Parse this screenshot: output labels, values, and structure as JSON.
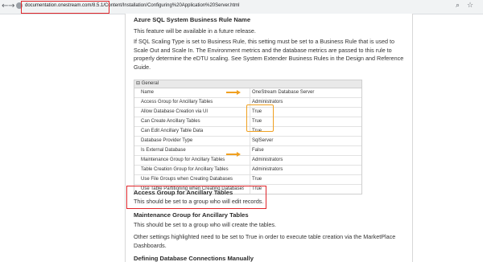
{
  "browser": {
    "back": "←",
    "forward": "→",
    "reload": "⟳",
    "url": "documentation.onestream.com/8.5.1/Content/Installation/Configuring%20Application%20Server.html"
  },
  "sections": {
    "azure_heading": "Azure SQL System Business Rule Name",
    "azure_p1": "This feature will be available in a future release.",
    "azure_p2": "If SQL Scaling Type is set to Business Rule, this setting must be set to a Business Rule that is used to Scale Out and Scale In.  The Environment metrics and the database metrics are passed to this rule to properly determine the eDTU scaling. See System Extender Business Rules in the Design and Reference Guide.",
    "table_group": "General",
    "table_toggle": "⊟",
    "rows": [
      {
        "name": "Name",
        "value": "OneStream Database Server"
      },
      {
        "name": "Access Group for Ancillary Tables",
        "value": "Administrators"
      },
      {
        "name": "Allow Database Creation via UI",
        "value": "True"
      },
      {
        "name": "Can Create Ancillary Tables",
        "value": "True"
      },
      {
        "name": "Can Edit Ancillary Table Data",
        "value": "True"
      },
      {
        "name": "Database Provider Type",
        "value": "SqlServer"
      },
      {
        "name": "Is External Database",
        "value": "False"
      },
      {
        "name": "Maintenance Group for Ancillary Tables",
        "value": "Administrators"
      },
      {
        "name": "Table Creation Group for Ancillary Tables",
        "value": "Administrators"
      },
      {
        "name": "Use File Groups when Creating Databases",
        "value": "True"
      },
      {
        "name": "Use Table Partitioning when Creating Databases",
        "value": "True"
      }
    ],
    "access_heading": "Access Group for Ancillary Tables",
    "access_p": "This should be set to a group who will edit records.",
    "maint_heading": "Maintenance Group for Ancillary Tables",
    "maint_p": "This should be set to a group who will create the tables.",
    "other_p": "Other settings highlighted need to be set to True in order to execute table creation via the MarketPlace Dashboards.",
    "defining_heading": "Defining Database Connections Manually"
  },
  "colors": {
    "red_highlight": "#e0262b",
    "orange_highlight": "#f0a020"
  }
}
